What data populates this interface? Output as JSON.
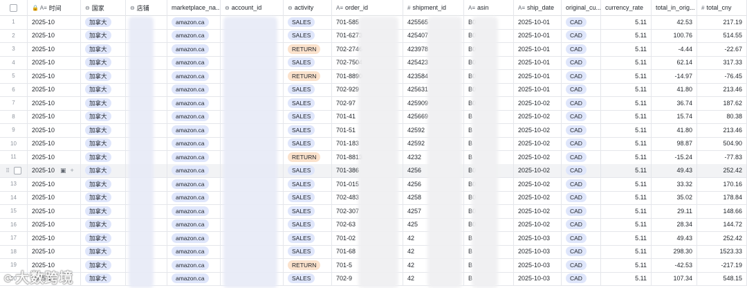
{
  "headers": [
    {
      "key": "row",
      "label": "",
      "icon": ""
    },
    {
      "key": "time",
      "label": "时间",
      "icon": "Aa lock"
    },
    {
      "key": "country",
      "label": "国家",
      "icon": "circle-chevron"
    },
    {
      "key": "store",
      "label": "店铺",
      "icon": "circle-chevron"
    },
    {
      "key": "marketplace",
      "label": "marketplace_na...",
      "icon": ""
    },
    {
      "key": "account",
      "label": "account_id",
      "icon": "circle-chevron"
    },
    {
      "key": "activity",
      "label": "activity",
      "icon": "circle-chevron"
    },
    {
      "key": "order",
      "label": "order_id",
      "icon": "Aa"
    },
    {
      "key": "shipment",
      "label": "shipment_id",
      "icon": "#"
    },
    {
      "key": "asin",
      "label": "asin",
      "icon": "Aa"
    },
    {
      "key": "ship_date",
      "label": "ship_date",
      "icon": "Aa"
    },
    {
      "key": "currency",
      "label": "original_cu...",
      "icon": ""
    },
    {
      "key": "rate",
      "label": "currency_rate",
      "icon": ""
    },
    {
      "key": "orig",
      "label": "total_in_orig...",
      "icon": ""
    },
    {
      "key": "cny",
      "label": "total_cny",
      "icon": "#"
    }
  ],
  "rows": [
    {
      "n": "1",
      "time": "2025-10",
      "country": "加拿大",
      "mp": "amazon.ca",
      "act": "SALES",
      "order": "701-585",
      "ship": "425565",
      "asin": "B0",
      "date": "2025-10-01",
      "cur": "CAD",
      "rate": "5.11",
      "orig": "42.53",
      "cny": "217.19"
    },
    {
      "n": "2",
      "time": "2025-10",
      "country": "加拿大",
      "mp": "amazon.ca",
      "act": "SALES",
      "order": "701-6273",
      "ship": "425407",
      "asin": "B0",
      "date": "2025-10-01",
      "cur": "CAD",
      "rate": "5.11",
      "orig": "100.76",
      "cny": "514.55"
    },
    {
      "n": "3",
      "time": "2025-10",
      "country": "加拿大",
      "mp": "amazon.ca",
      "act": "RETURN",
      "order": "702-2746",
      "ship": "423978",
      "asin": "B0",
      "date": "2025-10-01",
      "cur": "CAD",
      "rate": "5.11",
      "orig": "-4.44",
      "cny": "-22.67"
    },
    {
      "n": "4",
      "time": "2025-10",
      "country": "加拿大",
      "mp": "amazon.ca",
      "act": "SALES",
      "order": "702-7504",
      "ship": "425423",
      "asin": "B0",
      "date": "2025-10-01",
      "cur": "CAD",
      "rate": "5.11",
      "orig": "62.14",
      "cny": "317.33"
    },
    {
      "n": "5",
      "time": "2025-10",
      "country": "加拿大",
      "mp": "amazon.ca",
      "act": "RETURN",
      "order": "701-8890",
      "ship": "423584",
      "asin": "B0",
      "date": "2025-10-01",
      "cur": "CAD",
      "rate": "5.11",
      "orig": "-14.97",
      "cny": "-76.45"
    },
    {
      "n": "6",
      "time": "2025-10",
      "country": "加拿大",
      "mp": "amazon.ca",
      "act": "SALES",
      "order": "702-929",
      "ship": "425631",
      "asin": "B0",
      "date": "2025-10-01",
      "cur": "CAD",
      "rate": "5.11",
      "orig": "41.80",
      "cny": "213.46"
    },
    {
      "n": "7",
      "time": "2025-10",
      "country": "加拿大",
      "mp": "amazon.ca",
      "act": "SALES",
      "order": "702-97",
      "ship": "425909",
      "asin": "B0",
      "date": "2025-10-02",
      "cur": "CAD",
      "rate": "5.11",
      "orig": "36.74",
      "cny": "187.62"
    },
    {
      "n": "8",
      "time": "2025-10",
      "country": "加拿大",
      "mp": "amazon.ca",
      "act": "SALES",
      "order": "701-41",
      "ship": "425669",
      "asin": "B",
      "date": "2025-10-02",
      "cur": "CAD",
      "rate": "5.11",
      "orig": "15.74",
      "cny": "80.38"
    },
    {
      "n": "9",
      "time": "2025-10",
      "country": "加拿大",
      "mp": "amazon.ca",
      "act": "SALES",
      "order": "701-51",
      "ship": "42592",
      "asin": "B",
      "date": "2025-10-02",
      "cur": "CAD",
      "rate": "5.11",
      "orig": "41.80",
      "cny": "213.46"
    },
    {
      "n": "10",
      "time": "2025-10",
      "country": "加拿大",
      "mp": "amazon.ca",
      "act": "SALES",
      "order": "701-183",
      "ship": "42592",
      "asin": "B",
      "date": "2025-10-02",
      "cur": "CAD",
      "rate": "5.11",
      "orig": "98.87",
      "cny": "504.90"
    },
    {
      "n": "11",
      "time": "2025-10",
      "country": "加拿大",
      "mp": "amazon.ca",
      "act": "RETURN",
      "order": "701-8813",
      "ship": "4232",
      "asin": "B",
      "date": "2025-10-02",
      "cur": "CAD",
      "rate": "5.11",
      "orig": "-15.24",
      "cny": "-77.83"
    },
    {
      "n": "",
      "time": "2025-10",
      "country": "加拿大",
      "mp": "amazon.ca",
      "act": "SALES",
      "order": "701-386",
      "ship": "4256",
      "asin": "B0",
      "date": "2025-10-02",
      "cur": "CAD",
      "rate": "5.11",
      "orig": "49.43",
      "cny": "252.42"
    },
    {
      "n": "13",
      "time": "2025-10",
      "country": "加拿大",
      "mp": "amazon.ca",
      "act": "SALES",
      "order": "701-015",
      "ship": "4256",
      "asin": "B0",
      "date": "2025-10-02",
      "cur": "CAD",
      "rate": "5.11",
      "orig": "33.32",
      "cny": "170.16"
    },
    {
      "n": "14",
      "time": "2025-10",
      "country": "加拿大",
      "mp": "amazon.ca",
      "act": "SALES",
      "order": "702-483",
      "ship": "4258",
      "asin": "B0",
      "date": "2025-10-02",
      "cur": "CAD",
      "rate": "5.11",
      "orig": "35.02",
      "cny": "178.84"
    },
    {
      "n": "15",
      "time": "2025-10",
      "country": "加拿大",
      "mp": "amazon.ca",
      "act": "SALES",
      "order": "702-307",
      "ship": "4257",
      "asin": "B0",
      "date": "2025-10-02",
      "cur": "CAD",
      "rate": "5.11",
      "orig": "29.11",
      "cny": "148.66"
    },
    {
      "n": "16",
      "time": "2025-10",
      "country": "加拿大",
      "mp": "amazon.ca",
      "act": "SALES",
      "order": "702-63",
      "ship": "425",
      "asin": "B0",
      "date": "2025-10-02",
      "cur": "CAD",
      "rate": "5.11",
      "orig": "28.34",
      "cny": "144.72"
    },
    {
      "n": "17",
      "time": "2025-10",
      "country": "加拿大",
      "mp": "amazon.ca",
      "act": "SALES",
      "order": "701-02",
      "ship": "42",
      "asin": "B",
      "date": "2025-10-03",
      "cur": "CAD",
      "rate": "5.11",
      "orig": "49.43",
      "cny": "252.42"
    },
    {
      "n": "18",
      "time": "2025-10",
      "country": "加拿大",
      "mp": "amazon.ca",
      "act": "SALES",
      "order": "701-68",
      "ship": "42",
      "asin": "B",
      "date": "2025-10-03",
      "cur": "CAD",
      "rate": "5.11",
      "orig": "298.30",
      "cny": "1523.33"
    },
    {
      "n": "19",
      "time": "2025-10",
      "country": "加拿大",
      "mp": "amazon.ca",
      "act": "RETURN",
      "order": "701-5",
      "ship": "42",
      "asin": "B",
      "date": "2025-10-03",
      "cur": "CAD",
      "rate": "5.11",
      "orig": "-42.53",
      "cny": "-217.19"
    },
    {
      "n": "20",
      "time": "2025-10",
      "country": "加拿大",
      "mp": "amazon.ca",
      "act": "SALES",
      "order": "702-9",
      "ship": "42",
      "asin": "B",
      "date": "2025-10-03",
      "cur": "CAD",
      "rate": "5.11",
      "orig": "107.34",
      "cny": "548.15"
    }
  ],
  "watermark": "大数跨境",
  "colors": {
    "tag_blue": "#dfe6fb",
    "tag_return": "#fbe2cc",
    "grid_line": "#e4e6eb",
    "hover_row": "#f2f3f5"
  }
}
